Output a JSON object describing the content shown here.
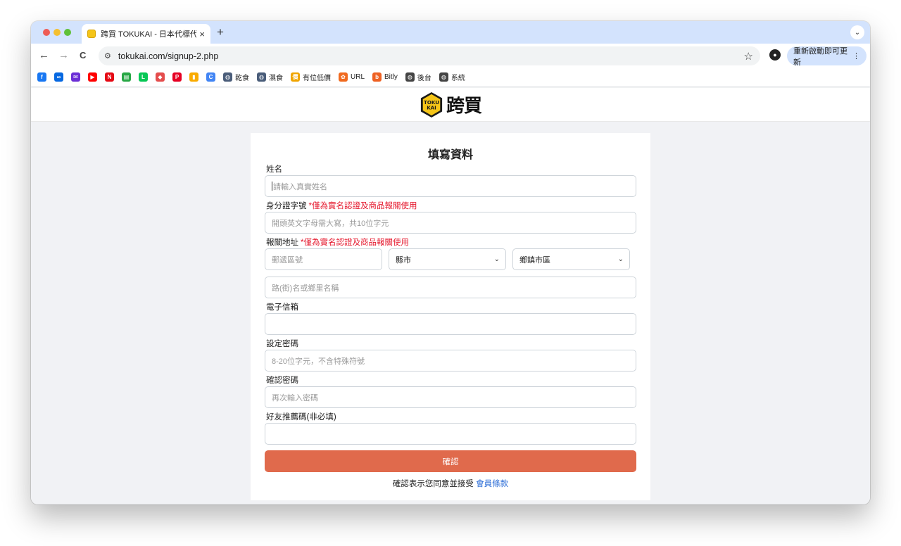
{
  "browser": {
    "tab_title": "跨買 TOKUKAI - 日本代標代購",
    "tab_close": "×",
    "new_tab": "+",
    "tab_search": "⌄",
    "url": "tokukai.com/signup-2.php",
    "back": "←",
    "forward": "→",
    "reload": "C",
    "star": "☆",
    "update_label": "重新啟動即可更新",
    "update_menu": "⋮"
  },
  "bookmarks": [
    {
      "icon": "facebook-icon",
      "label": "",
      "color": "#1877f2",
      "glyph": "f"
    },
    {
      "icon": "meta-icon",
      "label": "",
      "color": "#0668e1",
      "glyph": "∞"
    },
    {
      "icon": "mail-icon",
      "label": "",
      "color": "#6b2fd6",
      "glyph": "✉"
    },
    {
      "icon": "youtube-icon",
      "label": "",
      "color": "#ff0000",
      "glyph": "▶"
    },
    {
      "icon": "netflix-icon",
      "label": "",
      "color": "#e50914",
      "glyph": "N"
    },
    {
      "icon": "news-icon",
      "label": "",
      "color": "#27a745",
      "glyph": "▤"
    },
    {
      "icon": "line-icon",
      "label": "",
      "color": "#06c755",
      "glyph": "L"
    },
    {
      "icon": "shield-icon",
      "label": "",
      "color": "#e44d4d",
      "glyph": "◆"
    },
    {
      "icon": "pinterest-icon",
      "label": "",
      "color": "#e60023",
      "glyph": "P"
    },
    {
      "icon": "analytics-icon",
      "label": "",
      "color": "#f9ab00",
      "glyph": "▮"
    },
    {
      "icon": "chrome-c-icon",
      "label": "",
      "color": "#4285f4",
      "glyph": "C"
    },
    {
      "icon": "globe-icon",
      "label": "乾食",
      "color": "#4a5d7a",
      "glyph": "◍"
    },
    {
      "icon": "globe-icon",
      "label": "濕食",
      "color": "#4a5d7a",
      "glyph": "◍"
    },
    {
      "icon": "price-icon",
      "label": "有位低價",
      "color": "#f0a500",
      "glyph": "價"
    },
    {
      "icon": "url-icon",
      "label": "URL",
      "color": "#f06a1f",
      "glyph": "✿"
    },
    {
      "icon": "bitly-icon",
      "label": "Bitly",
      "color": "#ee6123",
      "glyph": "b"
    },
    {
      "icon": "globe-icon",
      "label": "後台",
      "color": "#444",
      "glyph": "◍"
    },
    {
      "icon": "globe-icon",
      "label": "系統",
      "color": "#444",
      "glyph": "◍"
    }
  ],
  "site": {
    "logo_badge_top": "TOKU",
    "logo_badge_bottom": "KAI",
    "logo_text": "跨買"
  },
  "form": {
    "title": "填寫資料",
    "name_label": "姓名",
    "name_placeholder": "請輸入真實姓名",
    "id_label": "身分證字號",
    "id_note": "*僅為實名認證及商品報關使用",
    "id_placeholder": "開頭英文字母需大寫，共10位字元",
    "address_label": "報關地址",
    "address_note": "*僅為實名認證及商品報關使用",
    "zip_placeholder": "郵遞區號",
    "county_select": "縣市",
    "district_select": "鄉鎮市區",
    "street_placeholder": "路(街)名或鄉里名稱",
    "email_label": "電子信箱",
    "password_label": "設定密碼",
    "password_placeholder": "8-20位字元，不含特殊符號",
    "confirm_label": "確認密碼",
    "confirm_placeholder": "再次輸入密碼",
    "referral_label": "好友推薦碼(非必填)",
    "submit": "確認",
    "terms_text": "確認表示您同意並接受",
    "terms_link": "會員條款"
  },
  "colors": {
    "accent": "#e06a4c",
    "required": "#e5182d",
    "link": "#2b6cd6",
    "tabstrip": "#d3e3fd"
  }
}
